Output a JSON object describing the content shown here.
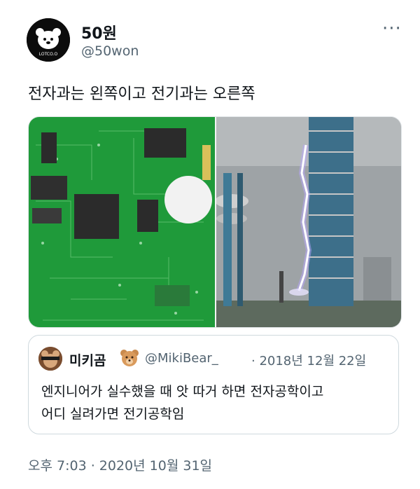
{
  "tweet": {
    "display_name": "50원",
    "handle": "@50won",
    "avatar_text": "LOTCO.O",
    "text": "전자과는 왼쪽이고 전기과는 오른쪽",
    "more_label": "···",
    "timestamp": "오후 7:03 · 2020년 10월 31일"
  },
  "media": {
    "left_image": "circuit-board-photo",
    "right_image": "lightning-arc-photo"
  },
  "quote": {
    "display_name": "미키곰",
    "handle": "@MikiBear_",
    "date": "· 2018년 12월 22일",
    "line1": "엔지니어가 실수했을 때 앗 따거 하면 전자공학이고",
    "line2": "어디 실려가면 전기공학임"
  },
  "colors": {
    "text": "#0f1419",
    "secondary": "#536471",
    "border": "#cfd9de",
    "pcb": "#1f9a3a"
  }
}
